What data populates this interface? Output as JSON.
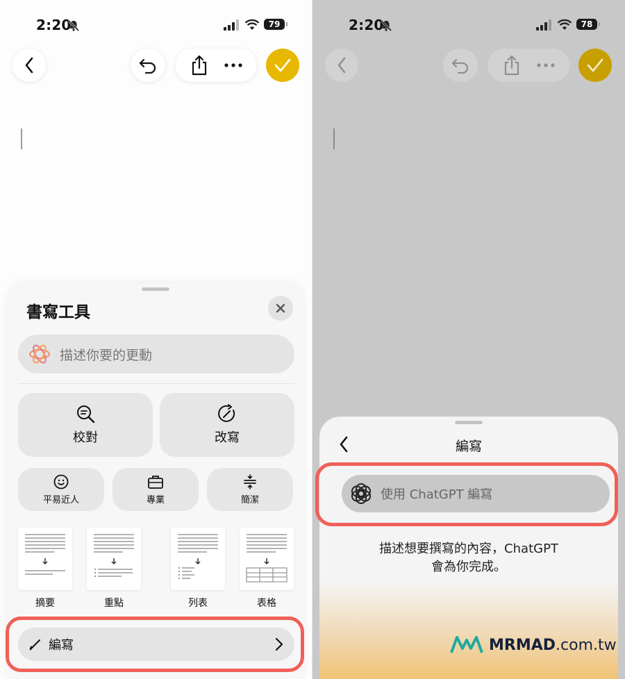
{
  "left": {
    "status": {
      "time": "2:20",
      "battery": "79"
    },
    "sheet": {
      "title": "書寫工具",
      "prompt_placeholder": "描述你要的更動",
      "primary_tools": [
        {
          "label": "校對",
          "icon": "magnifier-lines-icon"
        },
        {
          "label": "改寫",
          "icon": "rewrite-circle-icon"
        }
      ],
      "tone_tools": [
        {
          "label": "平易近人",
          "icon": "smiley-icon"
        },
        {
          "label": "專業",
          "icon": "briefcase-icon"
        },
        {
          "label": "簡潔",
          "icon": "divide-icon"
        }
      ],
      "formats": [
        {
          "label": "摘要"
        },
        {
          "label": "重點"
        },
        {
          "label": "列表"
        },
        {
          "label": "表格"
        }
      ],
      "compose_label": "編寫"
    }
  },
  "right": {
    "status": {
      "time": "2:20",
      "battery": "78"
    },
    "sheet": {
      "title": "編寫",
      "field_placeholder": "使用 ChatGPT 編寫",
      "description_line1": "描述想要撰寫的內容，ChatGPT",
      "description_line2": "會為你完成。"
    }
  },
  "watermark": {
    "brand": "MRMAD",
    "domain": ".com.tw"
  },
  "colors": {
    "highlight": "#f06058",
    "accent_check": "#e6b800"
  }
}
